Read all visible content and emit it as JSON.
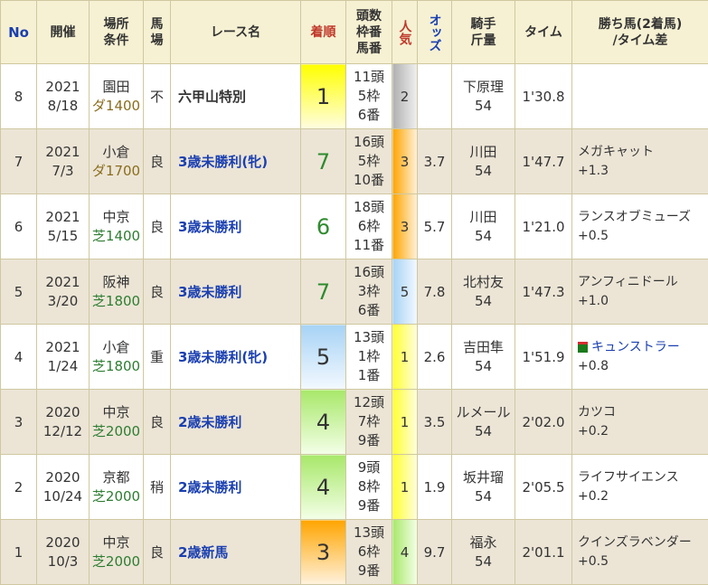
{
  "headers": {
    "no": "No",
    "date": "開催",
    "venue": "場所\n条件",
    "track": "馬\n場",
    "race": "レース名",
    "finish": "着順",
    "field": "頭数\n枠番\n馬番",
    "popularity": "人気",
    "odds": "オッズ",
    "jockey": "騎手\n斤量",
    "time": "タイム",
    "winner": "勝ち馬(2着馬)\n/タイム差"
  },
  "rows": [
    {
      "no": "8",
      "year": "2021",
      "md": "8/18",
      "place": "園田",
      "course": "ダ1400",
      "surface": "dirt",
      "track": "不",
      "race": "六甲山特別",
      "race_link": false,
      "finish": "1",
      "finish_class": "f1",
      "heads": "11頭",
      "frame": "5枠",
      "horse": "6番",
      "pop": "2",
      "pop_class": "pop2",
      "odds": "",
      "jockey": "下原理",
      "weight": "54",
      "time": "1'30.8",
      "winner": "",
      "winner_flag": false,
      "diff": ""
    },
    {
      "no": "7",
      "year": "2021",
      "md": "7/3",
      "place": "小倉",
      "course": "ダ1700",
      "surface": "dirt",
      "track": "良",
      "race": "3歳未勝利(牝)",
      "race_link": true,
      "finish": "7",
      "finish_class": "fg",
      "heads": "16頭",
      "frame": "5枠",
      "horse": "10番",
      "pop": "3",
      "pop_class": "pop3",
      "odds": "3.7",
      "jockey": "川田",
      "weight": "54",
      "time": "1'47.7",
      "winner": "メガキャット",
      "winner_flag": false,
      "diff": "+1.3"
    },
    {
      "no": "6",
      "year": "2021",
      "md": "5/15",
      "place": "中京",
      "course": "芝1400",
      "surface": "turf",
      "track": "良",
      "race": "3歳未勝利",
      "race_link": true,
      "finish": "6",
      "finish_class": "fg",
      "heads": "18頭",
      "frame": "6枠",
      "horse": "11番",
      "pop": "3",
      "pop_class": "pop3",
      "odds": "5.7",
      "jockey": "川田",
      "weight": "54",
      "time": "1'21.0",
      "winner": "ランスオブミューズ",
      "winner_flag": false,
      "diff": "+0.5"
    },
    {
      "no": "5",
      "year": "2021",
      "md": "3/20",
      "place": "阪神",
      "course": "芝1800",
      "surface": "turf",
      "track": "良",
      "race": "3歳未勝利",
      "race_link": true,
      "finish": "7",
      "finish_class": "fg",
      "heads": "16頭",
      "frame": "3枠",
      "horse": "6番",
      "pop": "5",
      "pop_class": "pop5",
      "odds": "7.8",
      "jockey": "北村友",
      "weight": "54",
      "time": "1'47.3",
      "winner": "アンフィニドール",
      "winner_flag": false,
      "diff": "+1.0"
    },
    {
      "no": "4",
      "year": "2021",
      "md": "1/24",
      "place": "小倉",
      "course": "芝1800",
      "surface": "turf",
      "track": "重",
      "race": "3歳未勝利(牝)",
      "race_link": true,
      "finish": "5",
      "finish_class": "f5",
      "heads": "13頭",
      "frame": "1枠",
      "horse": "1番",
      "pop": "1",
      "pop_class": "pop1",
      "odds": "2.6",
      "jockey": "吉田隼",
      "weight": "54",
      "time": "1'51.9",
      "winner": "キュンストラー",
      "winner_flag": true,
      "diff": "+0.8"
    },
    {
      "no": "3",
      "year": "2020",
      "md": "12/12",
      "place": "中京",
      "course": "芝2000",
      "surface": "turf",
      "track": "良",
      "race": "2歳未勝利",
      "race_link": true,
      "finish": "4",
      "finish_class": "f4",
      "heads": "12頭",
      "frame": "7枠",
      "horse": "9番",
      "pop": "1",
      "pop_class": "pop1",
      "odds": "3.5",
      "jockey": "ルメール",
      "weight": "54",
      "time": "2'02.0",
      "winner": "カツコ",
      "winner_flag": false,
      "diff": "+0.2"
    },
    {
      "no": "2",
      "year": "2020",
      "md": "10/24",
      "place": "京都",
      "course": "芝2000",
      "surface": "turf",
      "track": "稍",
      "race": "2歳未勝利",
      "race_link": true,
      "finish": "4",
      "finish_class": "f4",
      "heads": "9頭",
      "frame": "8枠",
      "horse": "9番",
      "pop": "1",
      "pop_class": "pop1",
      "odds": "1.9",
      "jockey": "坂井瑠",
      "weight": "54",
      "time": "2'05.5",
      "winner": "ライフサイエンス",
      "winner_flag": false,
      "diff": "+0.2"
    },
    {
      "no": "1",
      "year": "2020",
      "md": "10/3",
      "place": "中京",
      "course": "芝2000",
      "surface": "turf",
      "track": "良",
      "race": "2歳新馬",
      "race_link": true,
      "finish": "3",
      "finish_class": "f3",
      "heads": "13頭",
      "frame": "6枠",
      "horse": "9番",
      "pop": "4",
      "pop_class": "pop4",
      "odds": "9.7",
      "jockey": "福永",
      "weight": "54",
      "time": "2'01.1",
      "winner": "クインズラベンダー",
      "winner_flag": false,
      "diff": "+0.5"
    }
  ]
}
